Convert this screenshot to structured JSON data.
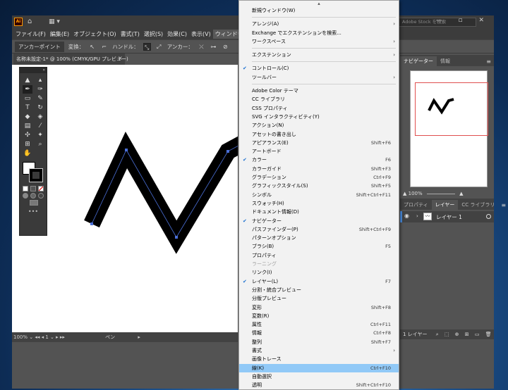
{
  "app": {
    "logo": "Ai",
    "stock_search_placeholder": "Adobe Stock を検索",
    "window_controls": "— ▫ ✕"
  },
  "menubar": [
    {
      "label": "ファイル(F)"
    },
    {
      "label": "編集(E)"
    },
    {
      "label": "オブジェクト(O)"
    },
    {
      "label": "書式(T)"
    },
    {
      "label": "選択(S)"
    },
    {
      "label": "効果(C)"
    },
    {
      "label": "表示(V)"
    },
    {
      "label": "ウィンドウ(W)"
    }
  ],
  "controlbar": {
    "anchor_point": "アンカーポイント",
    "convert": "変換：",
    "handle": "ハンドル：",
    "anchor": "アンカー："
  },
  "document": {
    "tab_title": "名称未設定-1* @ 100% (CMYK/GPU プレビュー)",
    "close": "×"
  },
  "statusbar": {
    "zoom": "100%",
    "artboard": "1",
    "tool": "ペン"
  },
  "toolbar": {
    "collapse": "»",
    "more": "•••",
    "tools": [
      {
        "name": "selection-tool",
        "glyph": "▲"
      },
      {
        "name": "direct-selection-tool",
        "glyph": "▴"
      },
      {
        "name": "pen-tool",
        "glyph": "✒",
        "selected": true
      },
      {
        "name": "curvature-tool",
        "glyph": "✑"
      },
      {
        "name": "rectangle-tool",
        "glyph": "▭"
      },
      {
        "name": "paintbrush-tool",
        "glyph": "✎"
      },
      {
        "name": "type-tool",
        "glyph": "T"
      },
      {
        "name": "rotate-tool",
        "glyph": "↻"
      },
      {
        "name": "eraser-tool",
        "glyph": "◆"
      },
      {
        "name": "shape-builder-tool",
        "glyph": "◈"
      },
      {
        "name": "gradient-tool",
        "glyph": "▤"
      },
      {
        "name": "eyedropper-tool",
        "glyph": "⁄"
      },
      {
        "name": "puppet-warp-tool",
        "glyph": "✣"
      },
      {
        "name": "symbol-sprayer-tool",
        "glyph": "✦"
      },
      {
        "name": "artboard-tool",
        "glyph": "⊞"
      },
      {
        "name": "zoom-tool",
        "glyph": "⌕"
      },
      {
        "name": "hand-tool",
        "glyph": "✋"
      },
      {
        "name": "empty-slot",
        "glyph": ""
      }
    ]
  },
  "navigator": {
    "tabs": [
      {
        "label": "ナビゲーター",
        "active": true
      },
      {
        "label": "情報",
        "active": false
      }
    ],
    "zoom": "100%"
  },
  "layers": {
    "tabs": [
      {
        "label": "プロパティ",
        "active": false
      },
      {
        "label": "レイヤー",
        "active": true
      },
      {
        "label": "CC ライブラリ",
        "active": false
      }
    ],
    "layer_name": "レイヤー 1",
    "footer": "1 レイヤー"
  },
  "window_menu": [
    {
      "label": "新規ウィンドウ(W)"
    },
    {
      "sep": true
    },
    {
      "label": "アレンジ(A)",
      "submenu": true
    },
    {
      "label": "Exchange でエクステンションを検索..."
    },
    {
      "label": "ワークスペース",
      "submenu": true
    },
    {
      "sep": true
    },
    {
      "label": "エクステンション",
      "submenu": true
    },
    {
      "sep": true
    },
    {
      "label": "コントロール(C)",
      "checked": true
    },
    {
      "label": "ツールバー",
      "submenu": true
    },
    {
      "sep": true
    },
    {
      "label": "Adobe Color テーマ"
    },
    {
      "label": "CC ライブラリ"
    },
    {
      "label": "CSS プロパティ"
    },
    {
      "label": "SVG インタラクティビティ(Y)"
    },
    {
      "label": "アクション(N)"
    },
    {
      "label": "アセットの書き出し"
    },
    {
      "label": "アピアランス(E)",
      "shortcut": "Shift+F6"
    },
    {
      "label": "アートボード"
    },
    {
      "label": "カラー",
      "shortcut": "F6",
      "checked": true
    },
    {
      "label": "カラーガイド",
      "shortcut": "Shift+F3"
    },
    {
      "label": "グラデーション",
      "shortcut": "Ctrl+F9"
    },
    {
      "label": "グラフィックスタイル(S)",
      "shortcut": "Shift+F5"
    },
    {
      "label": "シンボル",
      "shortcut": "Shift+Ctrl+F11"
    },
    {
      "label": "スウォッチ(H)"
    },
    {
      "label": "ドキュメント情報(D)"
    },
    {
      "label": "ナビゲーター",
      "checked": true
    },
    {
      "label": "パスファインダー(P)",
      "shortcut": "Shift+Ctrl+F9"
    },
    {
      "label": "パターンオプション"
    },
    {
      "label": "ブラシ(B)",
      "shortcut": "F5"
    },
    {
      "label": "プロパティ"
    },
    {
      "label": "ラーニング",
      "disabled": true
    },
    {
      "label": "リンク(I)"
    },
    {
      "label": "レイヤー(L)",
      "shortcut": "F7",
      "checked": true
    },
    {
      "label": "分割・統合プレビュー"
    },
    {
      "label": "分版プレビュー"
    },
    {
      "label": "変形",
      "shortcut": "Shift+F8"
    },
    {
      "label": "変数(R)"
    },
    {
      "label": "属性",
      "shortcut": "Ctrl+F11"
    },
    {
      "label": "情報",
      "shortcut": "Ctrl+F8"
    },
    {
      "label": "整列",
      "shortcut": "Shift+F7"
    },
    {
      "label": "書式",
      "submenu": true
    },
    {
      "label": "画像トレース"
    },
    {
      "label": "線(K)",
      "shortcut": "Ctrl+F10",
      "highlighted": true
    },
    {
      "label": "自動選択"
    },
    {
      "label": "透明",
      "shortcut": "Shift+Ctrl+F10"
    }
  ],
  "colors": {
    "menu_highlight": "#91c9f7",
    "check_blue": "#1a6fd0",
    "path_stroke": "#000000",
    "path_selection": "#4a6fd8",
    "navigator_viewbox": "#e05050"
  }
}
